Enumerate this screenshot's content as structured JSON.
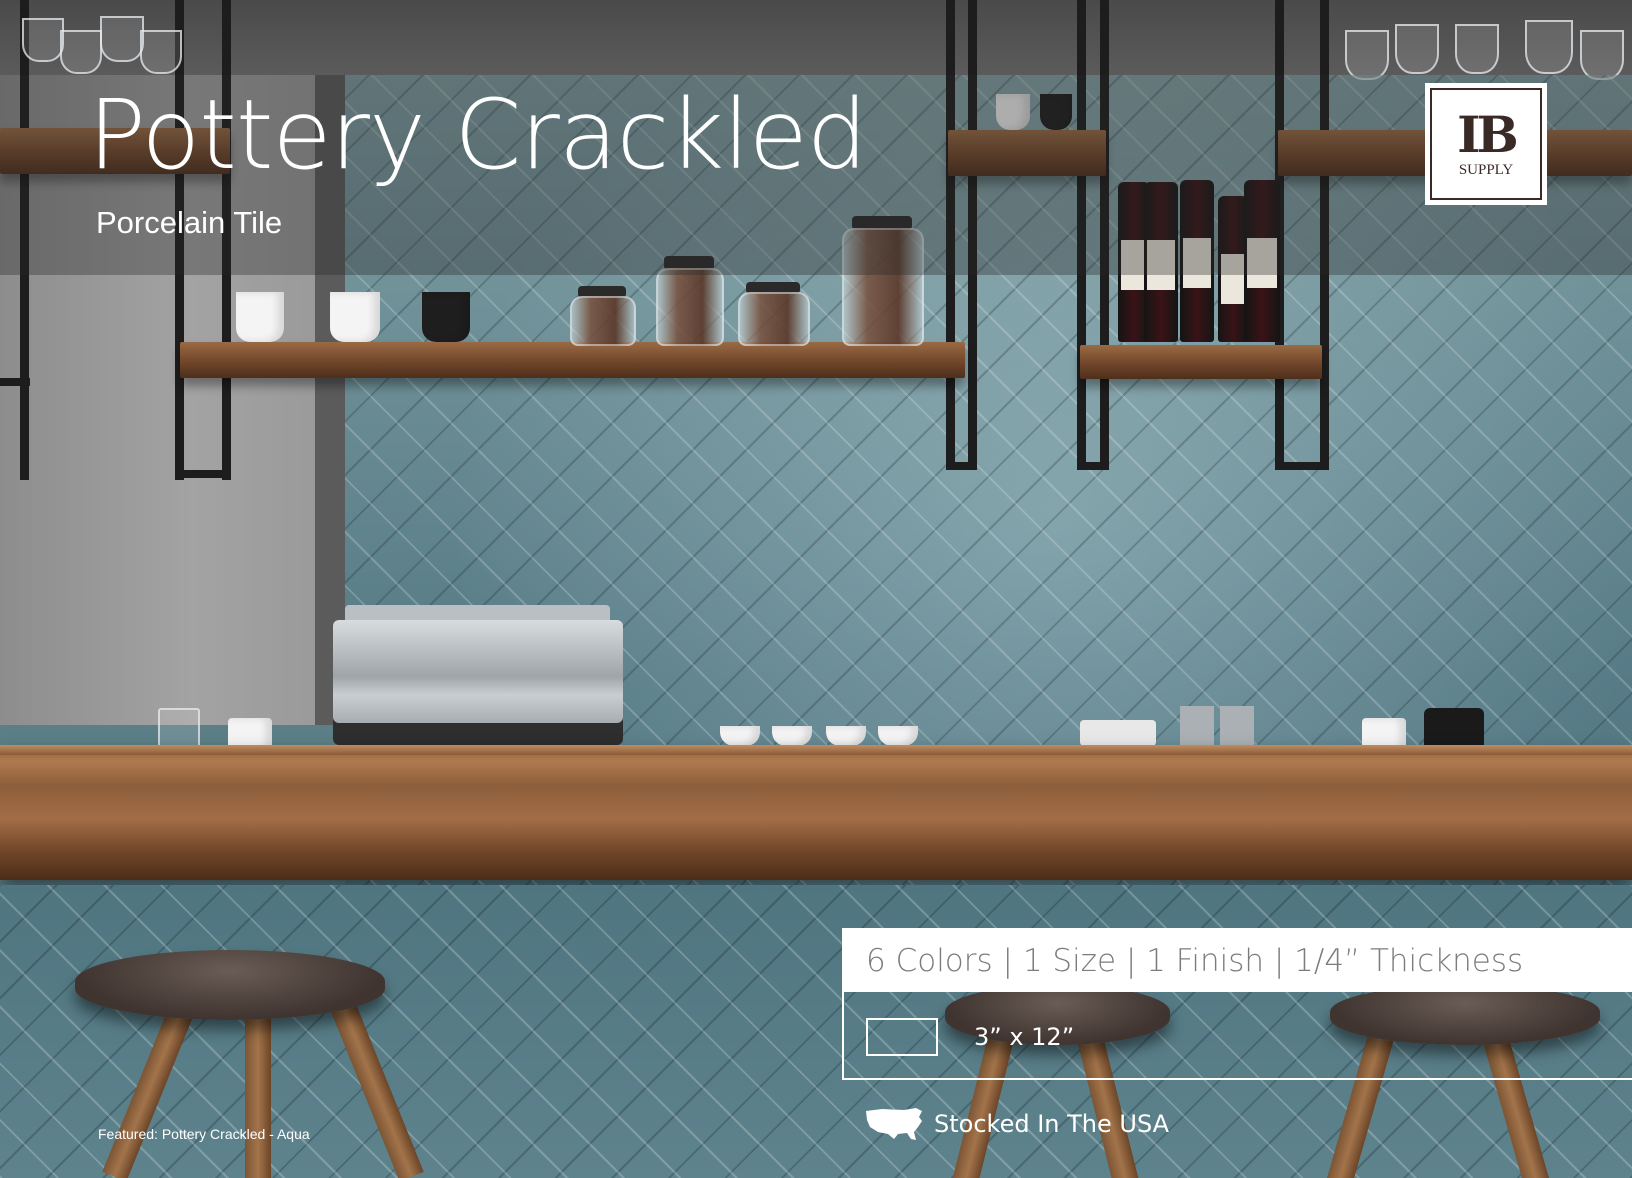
{
  "header": {
    "title": "Pottery Crackled",
    "subtitle": "Porcelain Tile"
  },
  "logo": {
    "mark": "IB",
    "text": "SUPPLY"
  },
  "specs": {
    "summary": "6 Colors | 1 Size  | 1 Finish | 1/4” Thickness",
    "size_label": "3” x 12”"
  },
  "footer": {
    "stocked": "Stocked In The USA",
    "featured": "Featured: Pottery Crackled - Aqua"
  },
  "colors": {
    "tile": "#5f8791",
    "text": "#ffffff",
    "spec_text": "#7c7c7c",
    "logo": "#3a2a26"
  },
  "icons": {
    "usa": "usa-map-icon"
  }
}
